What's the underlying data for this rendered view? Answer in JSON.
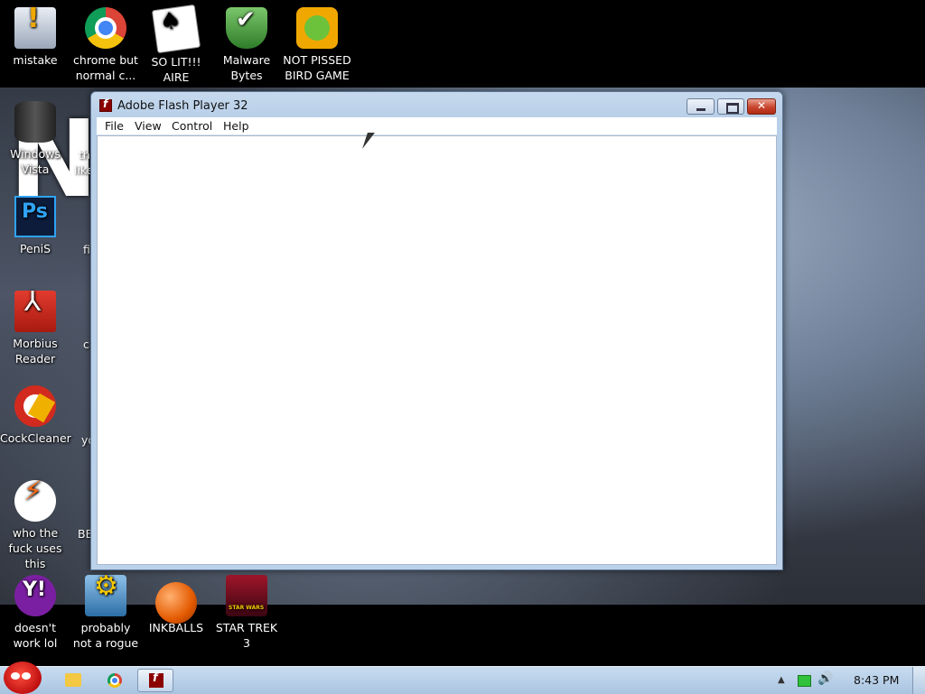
{
  "desktop": {
    "wallpaper_text": "N   S?",
    "top_icons": [
      {
        "label": "mistake",
        "icon": "warning-monitor-icon"
      },
      {
        "label": "chrome but normal c...",
        "icon": "chrome-icon"
      },
      {
        "label": "SO LIT!!! AIRE",
        "icon": "solitaire-cards-icon"
      },
      {
        "label": "Malware Bytes",
        "icon": "shield-check-icon"
      },
      {
        "label": "NOT PISSED BIRD GAME",
        "icon": "green-pig-icon"
      }
    ],
    "left_icons": [
      {
        "label": "Windows Vista",
        "icon": "trash-can-icon"
      },
      {
        "label": "PeniS",
        "icon": "photoshop-icon"
      },
      {
        "label": "Morbius Reader",
        "icon": "pdf-reader-icon"
      },
      {
        "label": "CockCleaner",
        "icon": "ccleaner-icon"
      },
      {
        "label": "who the fuck uses this",
        "icon": "lightning-bolt-icon"
      }
    ],
    "bottom_icons": [
      {
        "label": "doesn't work lol",
        "icon": "yahoo-messenger-icon"
      },
      {
        "label": "probably not a rogue",
        "icon": "gear-monitor-icon"
      },
      {
        "label": "INKBALLS",
        "icon": "ink-ball-icon"
      },
      {
        "label": "STAR TREK 3",
        "icon": "star-wars-game-icon"
      }
    ],
    "partial_labels": [
      "th",
      "like",
      "fi",
      "c",
      "yo",
      "BE"
    ]
  },
  "window": {
    "title": "Adobe Flash Player 32",
    "menu": [
      "File",
      "View",
      "Control",
      "Help"
    ]
  },
  "taskbar": {
    "clock": "8:43 PM",
    "pinned": [
      "explorer-icon",
      "chrome-icon",
      "flash-player-icon"
    ]
  }
}
